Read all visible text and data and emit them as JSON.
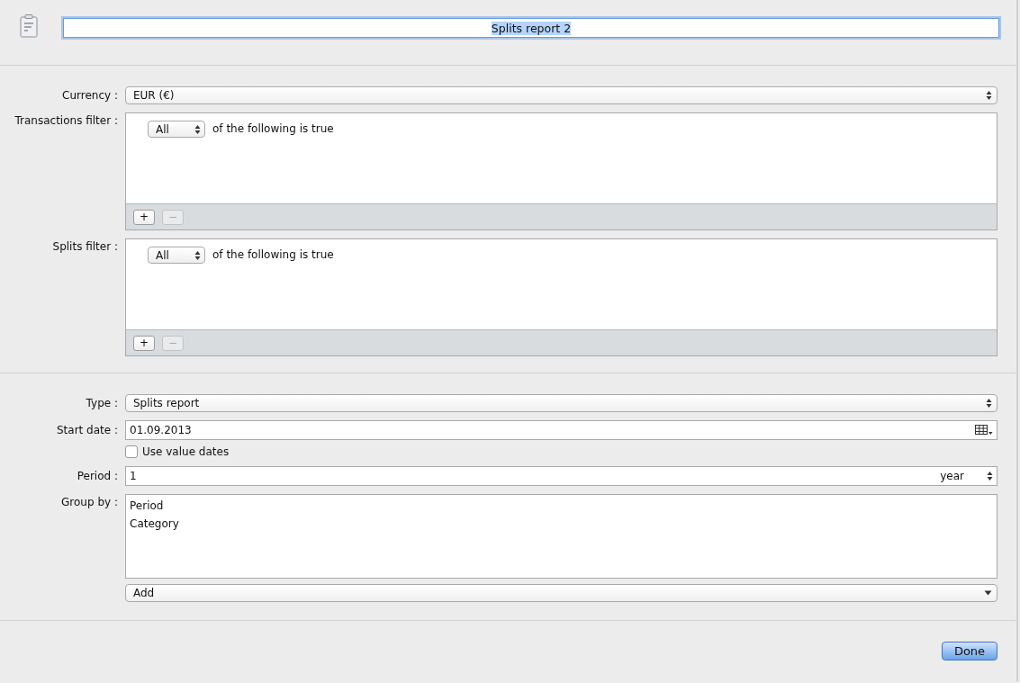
{
  "title_field": {
    "value": "Splits report 2",
    "selected": true
  },
  "form": {
    "currency": {
      "label": "Currency :",
      "value": "EUR (€)"
    },
    "filters": [
      {
        "label": "Transactions filter :",
        "match": "All",
        "text": "of the following is true",
        "buttons": [
          {
            "label": "+",
            "disabled": false
          },
          {
            "label": "−",
            "disabled": true
          }
        ]
      },
      {
        "label": "Splits filter :",
        "match": "All",
        "text": "of the following is true",
        "buttons": [
          {
            "label": "+",
            "disabled": false
          },
          {
            "label": "−",
            "disabled": true
          }
        ]
      }
    ],
    "type": {
      "label": "Type :",
      "value": "Splits report"
    },
    "start_date": {
      "label": "Start date :",
      "value": "01.09.2013"
    },
    "use_value_dates": {
      "label": "Use value dates",
      "checked": false
    },
    "period": {
      "label": "Period :",
      "value": "1",
      "unit": "year"
    },
    "group_by": {
      "label": "Group by :",
      "items": [
        "Period",
        "Category"
      ]
    },
    "add": {
      "value": "Add"
    }
  },
  "buttons": [
    {
      "label": "Done",
      "default": true
    }
  ]
}
